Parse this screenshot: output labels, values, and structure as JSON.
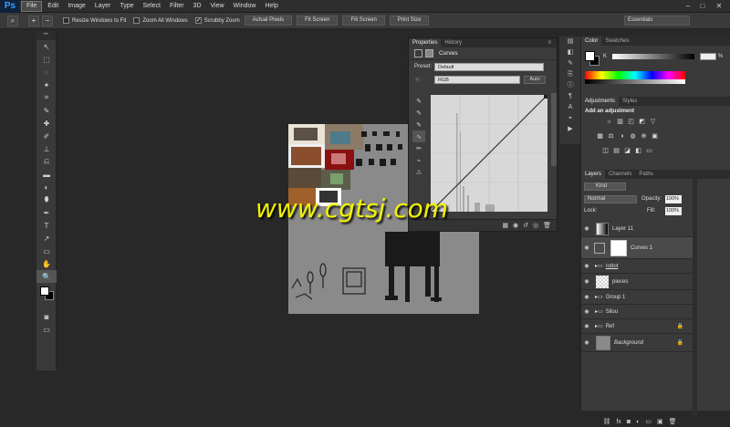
{
  "app": {
    "logo": "Ps"
  },
  "menu": [
    "File",
    "Edit",
    "Image",
    "Layer",
    "Type",
    "Select",
    "Filter",
    "3D",
    "View",
    "Window",
    "Help"
  ],
  "window_controls": [
    "–",
    "□",
    "✕"
  ],
  "options_bar": {
    "checks": [
      {
        "label": "Resize Windows to Fit",
        "checked": false
      },
      {
        "label": "Zoom All Windows",
        "checked": false
      },
      {
        "label": "Scrubby Zoom",
        "checked": true
      }
    ],
    "buttons": [
      "Actual Pixels",
      "Fit Screen",
      "Fill Screen",
      "Print Size"
    ],
    "workspace": "Essentials"
  },
  "tools": [
    "↖",
    "⬚",
    "◌",
    "✦",
    "⌗",
    "✎",
    "✚",
    "✐",
    "⊥",
    "⎌",
    "▬",
    "◐",
    "⬮",
    "✒",
    "T",
    "↗",
    "▭",
    "✋",
    "🔍"
  ],
  "properties": {
    "tabs": [
      "Properties",
      "History"
    ],
    "title": "Curves",
    "preset_label": "Preset:",
    "preset_value": "Default",
    "channel": "RGB",
    "auto_btn": "Auto"
  },
  "color_panel": {
    "tabs": [
      "Color",
      "Swatches"
    ],
    "k_label": "K",
    "percent": "%"
  },
  "adjustments": {
    "tabs": [
      "Adjustments",
      "Styles"
    ],
    "title": "Add an adjustment"
  },
  "layers_panel": {
    "tabs": [
      "Layers",
      "Channels",
      "Paths"
    ],
    "kind": "Kind",
    "blend": "Normal",
    "opacity_label": "Opacity:",
    "opacity": "100%",
    "lock_label": "Lock:",
    "fill_label": "Fill:",
    "fill": "100%",
    "layers": [
      {
        "name": "Layer 11",
        "type": "gradient"
      },
      {
        "name": "Curves 1",
        "type": "adjust"
      },
      {
        "name": "robot",
        "type": "group"
      },
      {
        "name": "pieces",
        "type": "checker"
      },
      {
        "name": "Group 1",
        "type": "group"
      },
      {
        "name": "Silou",
        "type": "group"
      },
      {
        "name": "Ref",
        "type": "group"
      },
      {
        "name": "Background",
        "type": "bg"
      }
    ]
  },
  "watermark": "www.cgtsj.com"
}
